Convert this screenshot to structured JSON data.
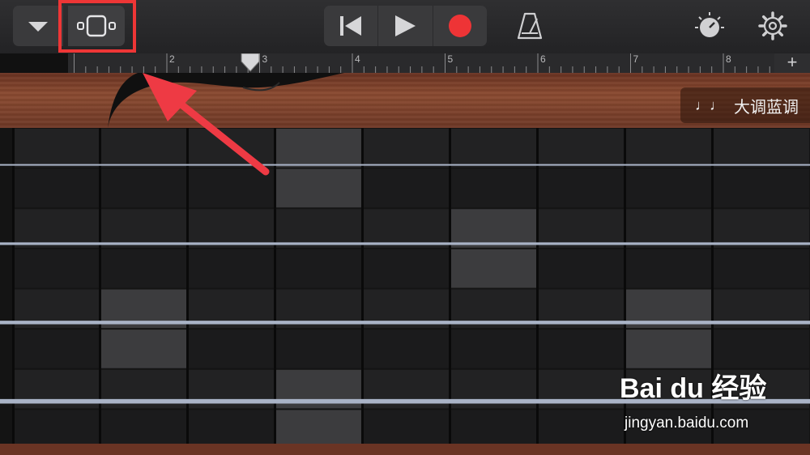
{
  "toolbar": {
    "icons": {
      "menu": "chevron-down-icon",
      "view": "tracks-view-icon",
      "rewind": "skip-back-icon",
      "play": "play-icon",
      "record": "record-icon",
      "metronome": "metronome-icon",
      "tempo": "tempo-dial-icon",
      "settings": "gear-icon"
    },
    "record_color": "#ee3436"
  },
  "ruler": {
    "bars": [
      "2",
      "3",
      "4",
      "5",
      "6",
      "7",
      "8"
    ],
    "add_label": "+"
  },
  "key": {
    "label": "大调蓝调",
    "icon": "music-note-icon"
  },
  "fretboard": {
    "strings": 4,
    "columns": 9,
    "lit_cells": [
      [
        3,
        0
      ],
      [
        3,
        1
      ],
      [
        5,
        2
      ],
      [
        5,
        3
      ],
      [
        1,
        4
      ],
      [
        7,
        4
      ],
      [
        1,
        5
      ],
      [
        7,
        5
      ],
      [
        3,
        6
      ],
      [
        3,
        7
      ]
    ]
  },
  "annotation": {
    "highlight_color": "#ee3636"
  },
  "watermark": {
    "logo": "Bai du 经验",
    "url": "jingyan.baidu.com"
  }
}
